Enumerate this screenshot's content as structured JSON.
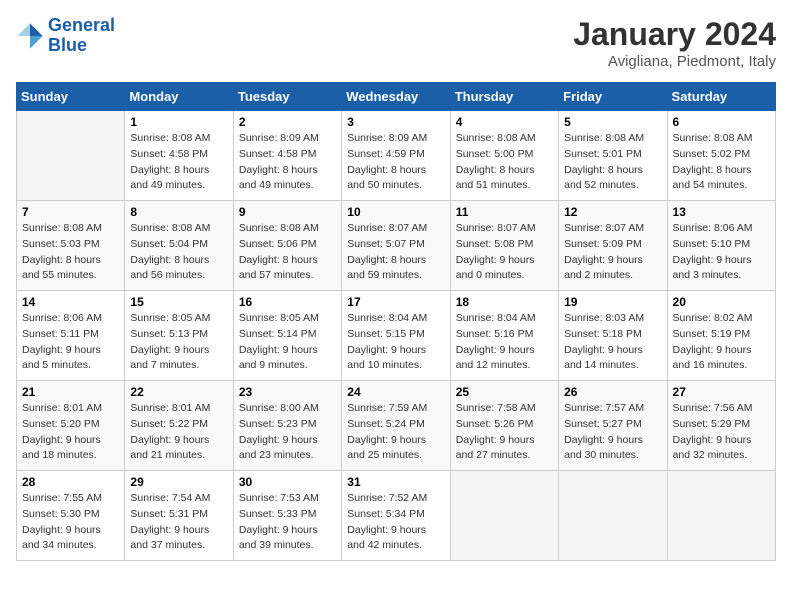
{
  "header": {
    "logo_line1": "General",
    "logo_line2": "Blue",
    "title": "January 2024",
    "location": "Avigliana, Piedmont, Italy"
  },
  "columns": [
    "Sunday",
    "Monday",
    "Tuesday",
    "Wednesday",
    "Thursday",
    "Friday",
    "Saturday"
  ],
  "weeks": [
    [
      {
        "day": "",
        "info": ""
      },
      {
        "day": "1",
        "info": "Sunrise: 8:08 AM\nSunset: 4:58 PM\nDaylight: 8 hours\nand 49 minutes."
      },
      {
        "day": "2",
        "info": "Sunrise: 8:09 AM\nSunset: 4:58 PM\nDaylight: 8 hours\nand 49 minutes."
      },
      {
        "day": "3",
        "info": "Sunrise: 8:09 AM\nSunset: 4:59 PM\nDaylight: 8 hours\nand 50 minutes."
      },
      {
        "day": "4",
        "info": "Sunrise: 8:08 AM\nSunset: 5:00 PM\nDaylight: 8 hours\nand 51 minutes."
      },
      {
        "day": "5",
        "info": "Sunrise: 8:08 AM\nSunset: 5:01 PM\nDaylight: 8 hours\nand 52 minutes."
      },
      {
        "day": "6",
        "info": "Sunrise: 8:08 AM\nSunset: 5:02 PM\nDaylight: 8 hours\nand 54 minutes."
      }
    ],
    [
      {
        "day": "7",
        "info": "Sunrise: 8:08 AM\nSunset: 5:03 PM\nDaylight: 8 hours\nand 55 minutes."
      },
      {
        "day": "8",
        "info": "Sunrise: 8:08 AM\nSunset: 5:04 PM\nDaylight: 8 hours\nand 56 minutes."
      },
      {
        "day": "9",
        "info": "Sunrise: 8:08 AM\nSunset: 5:06 PM\nDaylight: 8 hours\nand 57 minutes."
      },
      {
        "day": "10",
        "info": "Sunrise: 8:07 AM\nSunset: 5:07 PM\nDaylight: 8 hours\nand 59 minutes."
      },
      {
        "day": "11",
        "info": "Sunrise: 8:07 AM\nSunset: 5:08 PM\nDaylight: 9 hours\nand 0 minutes."
      },
      {
        "day": "12",
        "info": "Sunrise: 8:07 AM\nSunset: 5:09 PM\nDaylight: 9 hours\nand 2 minutes."
      },
      {
        "day": "13",
        "info": "Sunrise: 8:06 AM\nSunset: 5:10 PM\nDaylight: 9 hours\nand 3 minutes."
      }
    ],
    [
      {
        "day": "14",
        "info": "Sunrise: 8:06 AM\nSunset: 5:11 PM\nDaylight: 9 hours\nand 5 minutes."
      },
      {
        "day": "15",
        "info": "Sunrise: 8:05 AM\nSunset: 5:13 PM\nDaylight: 9 hours\nand 7 minutes."
      },
      {
        "day": "16",
        "info": "Sunrise: 8:05 AM\nSunset: 5:14 PM\nDaylight: 9 hours\nand 9 minutes."
      },
      {
        "day": "17",
        "info": "Sunrise: 8:04 AM\nSunset: 5:15 PM\nDaylight: 9 hours\nand 10 minutes."
      },
      {
        "day": "18",
        "info": "Sunrise: 8:04 AM\nSunset: 5:16 PM\nDaylight: 9 hours\nand 12 minutes."
      },
      {
        "day": "19",
        "info": "Sunrise: 8:03 AM\nSunset: 5:18 PM\nDaylight: 9 hours\nand 14 minutes."
      },
      {
        "day": "20",
        "info": "Sunrise: 8:02 AM\nSunset: 5:19 PM\nDaylight: 9 hours\nand 16 minutes."
      }
    ],
    [
      {
        "day": "21",
        "info": "Sunrise: 8:01 AM\nSunset: 5:20 PM\nDaylight: 9 hours\nand 18 minutes."
      },
      {
        "day": "22",
        "info": "Sunrise: 8:01 AM\nSunset: 5:22 PM\nDaylight: 9 hours\nand 21 minutes."
      },
      {
        "day": "23",
        "info": "Sunrise: 8:00 AM\nSunset: 5:23 PM\nDaylight: 9 hours\nand 23 minutes."
      },
      {
        "day": "24",
        "info": "Sunrise: 7:59 AM\nSunset: 5:24 PM\nDaylight: 9 hours\nand 25 minutes."
      },
      {
        "day": "25",
        "info": "Sunrise: 7:58 AM\nSunset: 5:26 PM\nDaylight: 9 hours\nand 27 minutes."
      },
      {
        "day": "26",
        "info": "Sunrise: 7:57 AM\nSunset: 5:27 PM\nDaylight: 9 hours\nand 30 minutes."
      },
      {
        "day": "27",
        "info": "Sunrise: 7:56 AM\nSunset: 5:29 PM\nDaylight: 9 hours\nand 32 minutes."
      }
    ],
    [
      {
        "day": "28",
        "info": "Sunrise: 7:55 AM\nSunset: 5:30 PM\nDaylight: 9 hours\nand 34 minutes."
      },
      {
        "day": "29",
        "info": "Sunrise: 7:54 AM\nSunset: 5:31 PM\nDaylight: 9 hours\nand 37 minutes."
      },
      {
        "day": "30",
        "info": "Sunrise: 7:53 AM\nSunset: 5:33 PM\nDaylight: 9 hours\nand 39 minutes."
      },
      {
        "day": "31",
        "info": "Sunrise: 7:52 AM\nSunset: 5:34 PM\nDaylight: 9 hours\nand 42 minutes."
      },
      {
        "day": "",
        "info": ""
      },
      {
        "day": "",
        "info": ""
      },
      {
        "day": "",
        "info": ""
      }
    ]
  ]
}
